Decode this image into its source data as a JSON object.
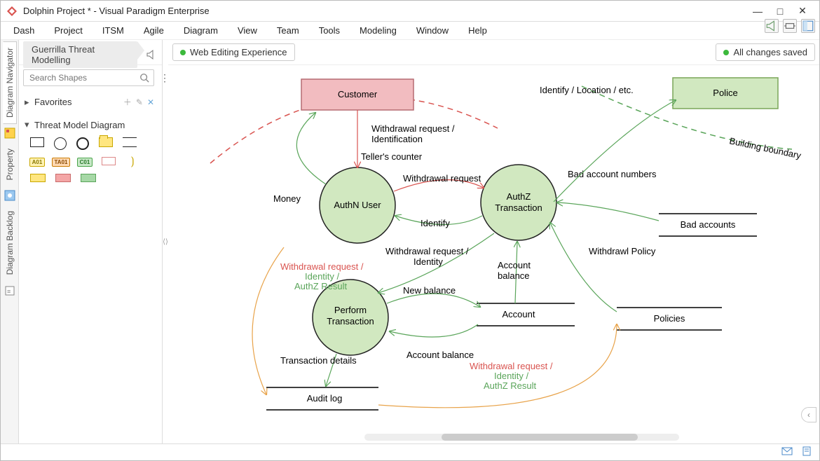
{
  "window": {
    "title": "Dolphin Project * - Visual Paradigm Enterprise"
  },
  "menu": [
    "Dash",
    "Project",
    "ITSM",
    "Agile",
    "Diagram",
    "View",
    "Team",
    "Tools",
    "Modeling",
    "Window",
    "Help"
  ],
  "siderail": {
    "tabs": [
      "Diagram Navigator",
      "Property",
      "Diagram Backlog"
    ]
  },
  "left": {
    "breadcrumb": "Guerrilla Threat Modelling",
    "search_placeholder": "Search Shapes",
    "favorites_label": "Favorites",
    "palette_label": "Threat Model Diagram"
  },
  "canvas": {
    "tab_label": "Web Editing Experience",
    "save_label": "All changes saved",
    "shapes": {
      "customer": "Customer",
      "police": "Police",
      "authn": "AuthN User",
      "authz_l1": "AuthZ",
      "authz_l2": "Transaction",
      "perform_l1": "Perform",
      "perform_l2": "Transaction",
      "bad_accounts": "Bad accounts",
      "policies": "Policies",
      "account": "Account",
      "audit_log": "Audit log"
    },
    "labels": {
      "identify_loc": "Identify / Location / etc.",
      "building_boundary": "Building boundary",
      "withdraw_req_ident_l1": "Withdrawal request /",
      "withdraw_req_ident_l2": "Identification",
      "teller": "Teller's counter",
      "withdrawal_request": "Withdrawal request",
      "money": "Money",
      "identify": "Identify",
      "bad_acct_num": "Bad account numbers",
      "wr_identity_l1": "Withdrawal request /",
      "wr_identity_l2": "Identity",
      "acct_balance": "Account",
      "acct_balance2": "balance",
      "withdrawl_policy": "Withdrawl Policy",
      "new_balance": "New balance",
      "acct_balance_long": "Account balance",
      "txn_details": "Transaction details",
      "wr_id_authz_l1": "Withdrawal request /",
      "wr_id_authz_l2": "Identity /",
      "wr_id_authz_l3": "AuthZ Result"
    }
  }
}
